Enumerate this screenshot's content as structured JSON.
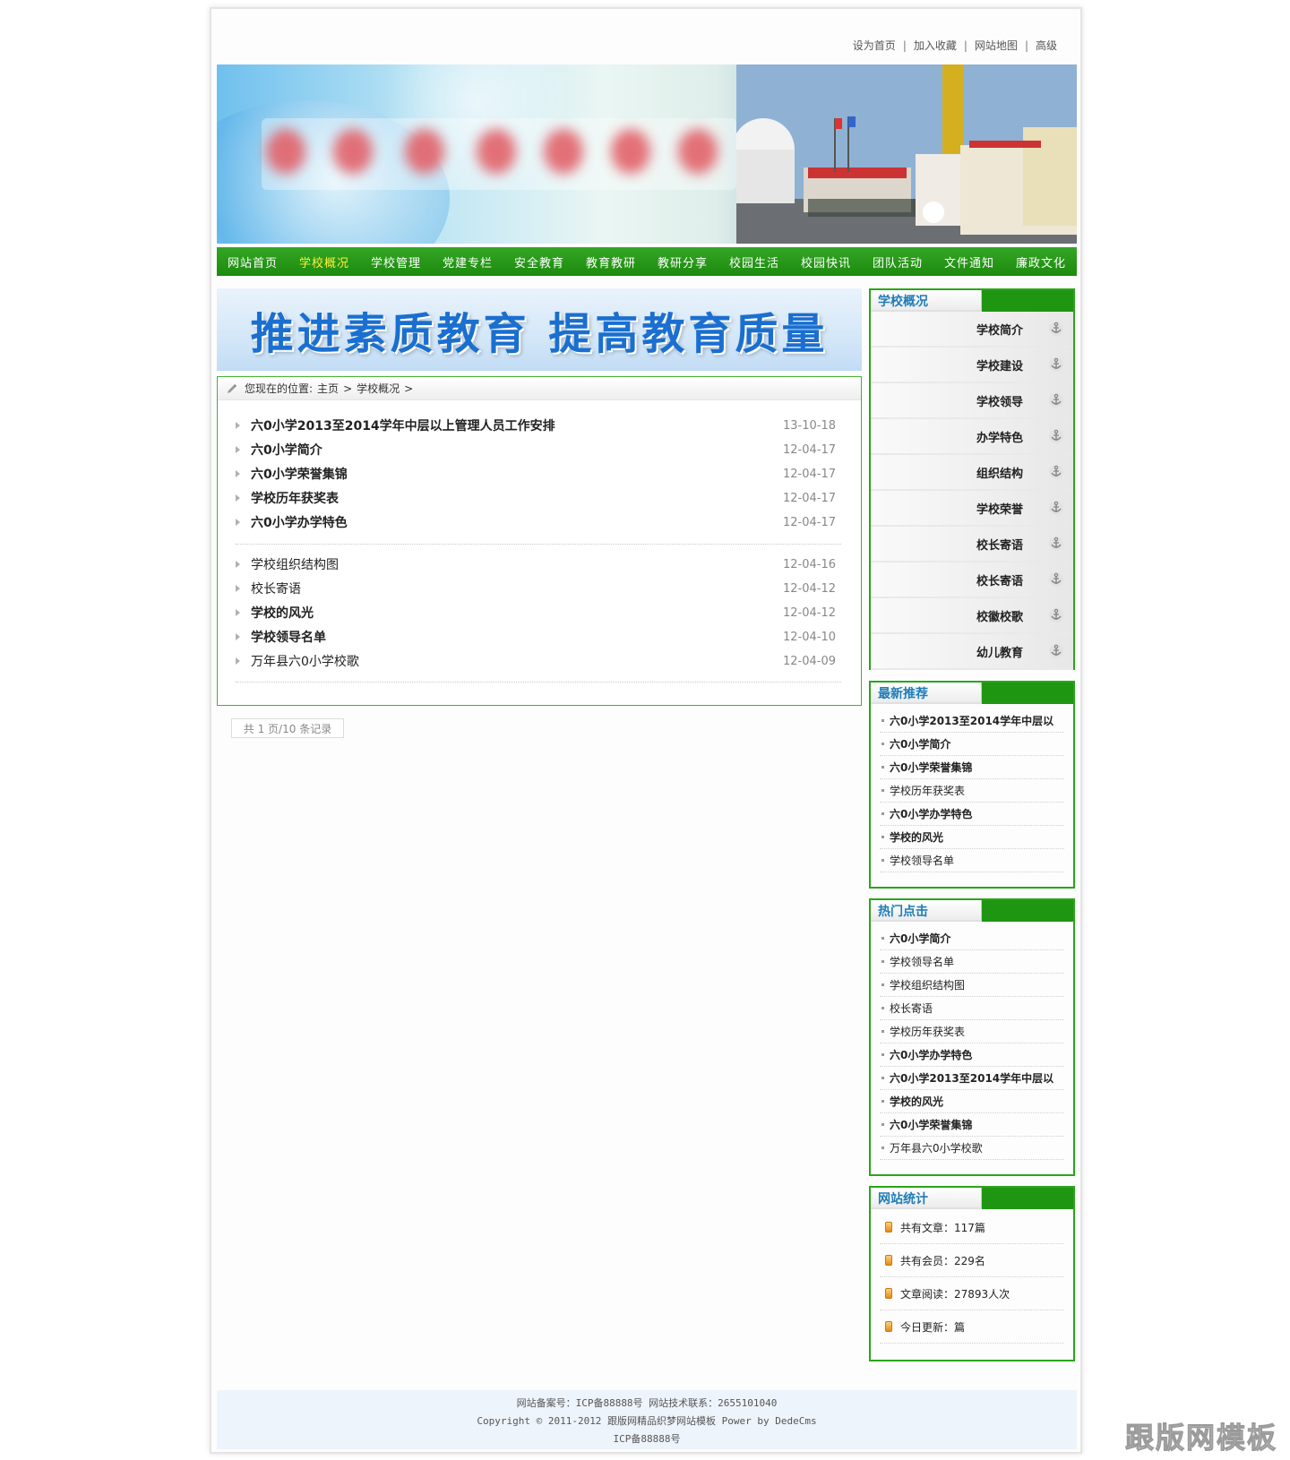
{
  "toplinks": [
    "设为首页",
    "加入收藏",
    "网站地图",
    "高级"
  ],
  "nav": [
    "网站首页",
    "学校概况",
    "学校管理",
    "党建专栏",
    "安全教育",
    "教育教研",
    "教研分享",
    "校园生活",
    "校园快讯",
    "团队活动",
    "文件通知",
    "廉政文化"
  ],
  "nav_active": "学校概况",
  "slogan": "推进素质教育 提高教育质量",
  "crumb": {
    "prefix": "您现在的位置:",
    "home": "主页",
    "sep1": ">",
    "current": "学校概况",
    "sep2": ">"
  },
  "articles": [
    {
      "title": "六0小学2013至2014学年中层以上管理人员工作安排",
      "date": "13-10-18"
    },
    {
      "title": "六0小学简介",
      "date": "12-04-17"
    },
    {
      "title": "六0小学荣誉集锦",
      "date": "12-04-17"
    },
    {
      "title": "学校历年获奖表",
      "date": "12-04-17"
    },
    {
      "title": "六0小学办学特色",
      "date": "12-04-17"
    },
    {
      "title": "学校组织结构图",
      "date": "12-04-16"
    },
    {
      "title": "校长寄语",
      "date": "12-04-12"
    },
    {
      "title": "学校的风光",
      "date": "12-04-12"
    },
    {
      "title": "学校领导名单",
      "date": "12-04-10"
    },
    {
      "title": "万年县六0小学校歌",
      "date": "12-04-09"
    }
  ],
  "pager": "共 1 页/10 条记录",
  "categories": {
    "title": "学校概况",
    "items": [
      "学校简介",
      "学校建设",
      "学校领导",
      "办学特色",
      "组织结构",
      "学校荣誉",
      "校长寄语",
      "校长寄语",
      "校徽校歌",
      "幼儿教育"
    ]
  },
  "recommend": {
    "title": "最新推荐",
    "items": [
      "六0小学2013至2014学年中层以",
      "六0小学简介",
      "六0小学荣誉集锦",
      "学校历年获奖表",
      "六0小学办学特色",
      "学校的风光",
      "学校领导名单"
    ]
  },
  "hot": {
    "title": "热门点击",
    "items": [
      "六0小学简介",
      "学校领导名单",
      "学校组织结构图",
      "校长寄语",
      "学校历年获奖表",
      "六0小学办学特色",
      "六0小学2013至2014学年中层以",
      "学校的风光",
      "六0小学荣誉集锦",
      "万年县六0小学校歌"
    ]
  },
  "stats": {
    "title": "网站统计",
    "items": [
      "共有文章：117篇",
      "共有会员：229名",
      "文章阅读：27893人次",
      "今日更新：篇"
    ]
  },
  "footer": {
    "line1": "网站备案号：ICP备88888号 网站技术联系：2655101040",
    "line2": "Copyright © 2011-2012 跟版网精品织梦网站模板 Power by DedeCms",
    "line3": "ICP备88888号"
  },
  "watermark": "跟版网模板",
  "colors": {
    "nav_green": "#1f9611",
    "accent_blue": "#1e7cb8",
    "active_nav": "#ffef3a"
  }
}
